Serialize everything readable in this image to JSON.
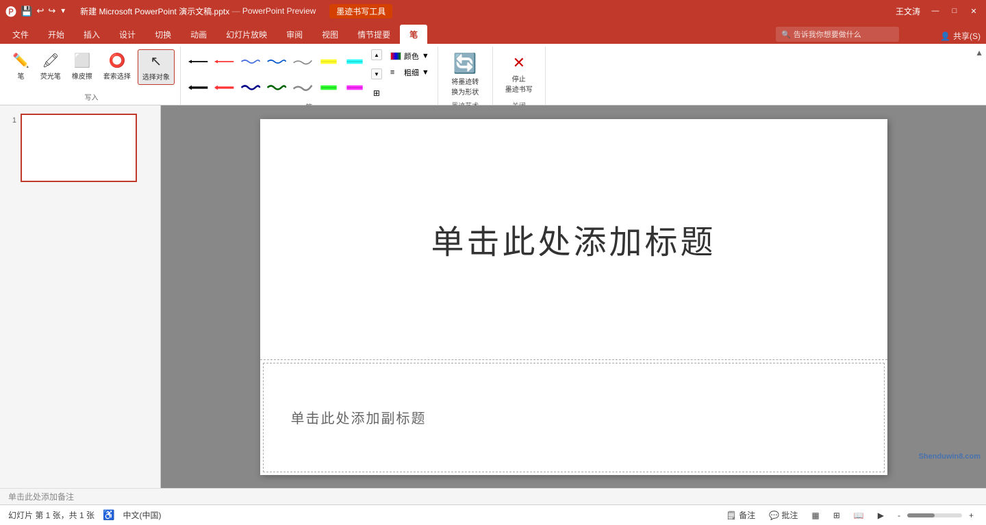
{
  "titlebar": {
    "save_icon": "💾",
    "undo_icon": "↩",
    "redo_icon": "↪",
    "customize_icon": "▼",
    "filename": "新建 Microsoft PowerPoint 演示文稿.pptx",
    "sep": "—",
    "appname": "PowerPoint Preview",
    "ink_tab": "墨迹书写工具",
    "user": "王文涛",
    "win_min": "—",
    "win_max": "□",
    "win_close": "✕"
  },
  "ribbon_tabs": {
    "tabs": [
      "文件",
      "开始",
      "插入",
      "设计",
      "切换",
      "动画",
      "幻灯片放映",
      "审阅",
      "视图",
      "情节提要",
      "笔"
    ],
    "active_tab": "笔",
    "search_placeholder": "告诉我你想要做什么",
    "share_label": "共享(S)"
  },
  "ribbon": {
    "groups": [
      {
        "name": "写入",
        "tools": [
          {
            "label": "笔",
            "icon": "✏️"
          },
          {
            "label": "荧光笔",
            "icon": "🖊"
          },
          {
            "label": "橡皮擦",
            "icon": "⬜"
          },
          {
            "label": "套索选择",
            "icon": "⭕"
          },
          {
            "label": "选择对象",
            "icon": "↖",
            "active": true
          }
        ]
      },
      {
        "name": "笔",
        "pens_row1": [
          "pen1",
          "pen2",
          "pen3",
          "pen4",
          "pen5",
          "color1",
          "color2"
        ],
        "pens_row2": [
          "pen6",
          "pen7",
          "pen8",
          "pen9",
          "pen10",
          "color3",
          "color4"
        ],
        "color_label": "颜色",
        "thickness_label": "粗细"
      },
      {
        "name": "墨迹艺术",
        "tools": [
          {
            "label": "将墨迹转\n换为形状",
            "icon": "🔄"
          }
        ]
      },
      {
        "name": "关闭",
        "tools": [
          {
            "label": "停止\n墨迹书写",
            "icon": "✕"
          }
        ]
      }
    ]
  },
  "slide_panel": {
    "slide_number": "1"
  },
  "slide": {
    "title_placeholder": "单击此处添加标题",
    "subtitle_placeholder": "单击此处添加副标题"
  },
  "notes_bar": {
    "text": "单击此处添加备注"
  },
  "status_bar": {
    "slide_info": "幻灯片 第 1 张，共 1 张",
    "lang": "中文(中国)",
    "notes_btn": "备注",
    "comments_btn": "批注",
    "view_normal": "▦",
    "view_slide_sorter": "⊞",
    "view_reading": "📖",
    "view_slideshow": "▶",
    "zoom_out": "-",
    "zoom_in": "+",
    "zoom_level": "—"
  },
  "watermark": {
    "text": "Shenduwin8.com"
  },
  "pen_colors": {
    "row1": [
      "#000000",
      "#ff0000",
      "#0000ff",
      "#4169e1",
      "#808080"
    ],
    "row2": [
      "#000000",
      "#ff0000",
      "#0000aa",
      "#006400",
      "#808080"
    ],
    "highlight1": "#ffff00",
    "highlight2": "#00ffff",
    "highlight3": "#00ff00",
    "highlight4": "#ff00ff"
  }
}
